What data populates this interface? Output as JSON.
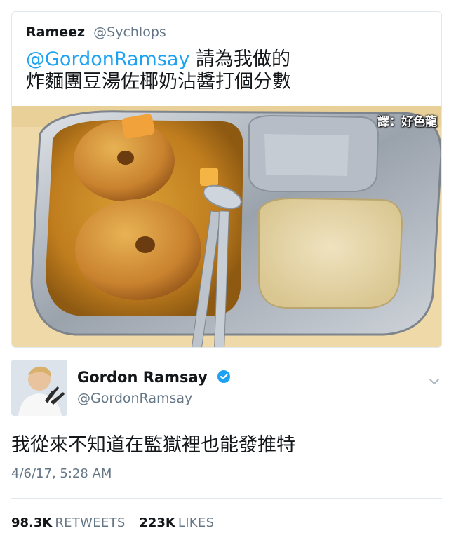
{
  "quoted_tweet": {
    "author_name": "Rameez",
    "author_handle": "@Sychlops",
    "mention": "@GordonRamsay",
    "text_line1": "請為我做的",
    "text_line2": "炸麵團豆湯佐椰奶沾醬打個分數",
    "watermark": "譯：好色龍"
  },
  "tweet": {
    "author_name": "Gordon Ramsay",
    "author_handle": "@GordonRamsay",
    "text": "我從來不知道在監獄裡也能發推特",
    "timestamp": "4/6/17, 5:28 AM",
    "retweets_count": "98.3K",
    "retweets_label": "RETWEETS",
    "likes_count": "223K",
    "likes_label": "LIKES"
  },
  "colors": {
    "link": "#1da1f2",
    "secondary_text": "#657786",
    "verified": "#1da1f2",
    "divider": "#e1e8ed"
  },
  "icons": {
    "verified": "verified-badge-icon",
    "more": "chevron-down-icon"
  }
}
